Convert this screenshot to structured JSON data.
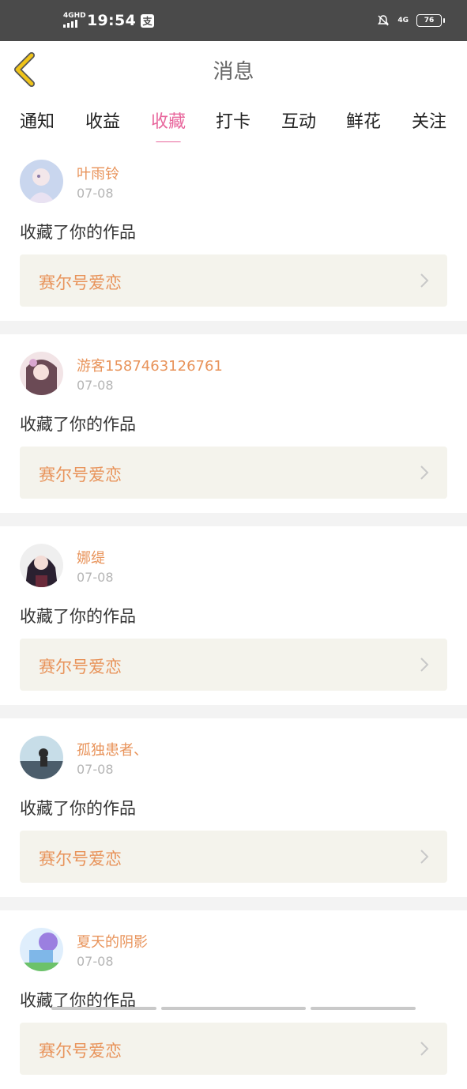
{
  "status_bar": {
    "network_left": "4GHD",
    "time": "19:54",
    "app_icon": "支",
    "network_right": "4G",
    "battery": "76"
  },
  "header": {
    "title": "消息",
    "back_icon": "chevron-left-icon",
    "back_color": "#f0c419"
  },
  "tabs": [
    {
      "label": "通知"
    },
    {
      "label": "收益"
    },
    {
      "label": "收藏",
      "active": true
    },
    {
      "label": "打卡"
    },
    {
      "label": "互动"
    },
    {
      "label": "鲜花"
    },
    {
      "label": "关注"
    }
  ],
  "accent_color": "#e8669c",
  "name_color": "#e8935a",
  "messages": [
    {
      "username": "叶雨铃",
      "date": "07-08",
      "action": "收藏了你的作品",
      "work_title": "赛尔号爱恋"
    },
    {
      "username": "游客1587463126761",
      "date": "07-08",
      "action": "收藏了你的作品",
      "work_title": "赛尔号爱恋"
    },
    {
      "username": "娜缇",
      "date": "07-08",
      "action": "收藏了你的作品",
      "work_title": "赛尔号爱恋"
    },
    {
      "username": "孤独患者、",
      "date": "07-08",
      "action": "收藏了你的作品",
      "work_title": "赛尔号爱恋"
    },
    {
      "username": "夏天的阴影",
      "date": "07-08",
      "action": "收藏了你的作品",
      "work_title": "赛尔号爱恋"
    }
  ]
}
